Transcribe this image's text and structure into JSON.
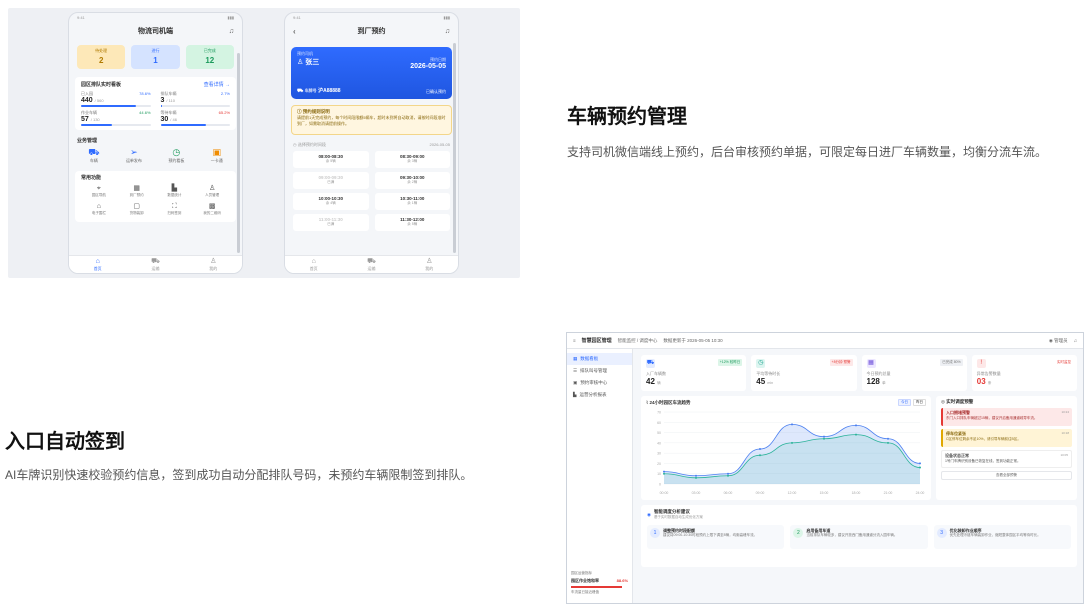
{
  "colors": {
    "accent": "#2f6bff",
    "success": "#1c9a5c",
    "warning": "#e0a800",
    "danger": "#e53935"
  },
  "phone1": {
    "title": "物流司机端",
    "stats": [
      {
        "label": "待处理",
        "value": "2"
      },
      {
        "label": "进行",
        "value": "1"
      },
      {
        "label": "已完成",
        "value": "12"
      }
    ],
    "realtime": {
      "title": "园区排队实时看板",
      "link": "查看详情 →",
      "metrics": [
        {
          "label": "已入园",
          "value": "440",
          "total": "/ 560",
          "pct": "78.6%",
          "fill": 0.786
        },
        {
          "label": "排队车辆",
          "value": "3",
          "total": "/ 110",
          "pct": "2.7%",
          "fill": 0.027
        },
        {
          "label": "作业车辆",
          "value": "57",
          "total": "/ 130",
          "pct": "44.6%",
          "fill": 0.446
        },
        {
          "label": "等待车辆",
          "value": "30",
          "total": "/ 46",
          "pct": "65.2%",
          "fill": 0.652
        }
      ]
    },
    "business_title": "业务管理",
    "business": [
      {
        "icon": "truck-icon",
        "label": "车辆"
      },
      {
        "icon": "send-icon",
        "label": "运单发布"
      },
      {
        "icon": "clock-icon",
        "label": "预约看板"
      },
      {
        "icon": "wallet-icon",
        "label": "一卡通"
      }
    ],
    "common_title": "常用功能",
    "common": [
      {
        "icon": "pin-icon",
        "label": "园区导航"
      },
      {
        "icon": "calendar-icon",
        "label": "到厂预约"
      },
      {
        "icon": "chart-icon",
        "label": "数据统计"
      },
      {
        "icon": "user-add-icon",
        "label": "人员管理"
      },
      {
        "icon": "tag-icon",
        "label": "电子围栏"
      },
      {
        "icon": "box-icon",
        "label": "货物装卸"
      },
      {
        "icon": "scan-icon",
        "label": "扫码签到"
      },
      {
        "icon": "qr-icon",
        "label": "我的二维码"
      }
    ],
    "tabs": [
      "首页",
      "运输",
      "我的"
    ]
  },
  "phone2": {
    "title": "到厂预约",
    "booking": {
      "label_driver": "预约司机",
      "driver": "张三",
      "label_date": "预约日期",
      "date": "2026-05-05",
      "label_plate": "车牌号",
      "plate": "沪A88888",
      "status": "已确认预约"
    },
    "notice_title": "预约规则说明",
    "notice_text": "请提前1天完成预约，每个时间段限额5辆车，超时未到将自动取消，请按时间段准时到厂，如需取消请提前操作。",
    "slots_title": "选择预约时间段",
    "slots_date": "2026-05-05",
    "slots": [
      {
        "time": "08:00-08:30",
        "left": "余 5辆",
        "available": true
      },
      {
        "time": "08:30-09:00",
        "left": "余 3辆",
        "available": true
      },
      {
        "time": "09:00-09:30",
        "left": "已满",
        "available": false
      },
      {
        "time": "09:30-10:00",
        "left": "余 2辆",
        "available": true
      },
      {
        "time": "10:00-10:30",
        "left": "余 4辆",
        "available": true
      },
      {
        "time": "10:30-11:00",
        "left": "余 1辆",
        "available": true
      },
      {
        "time": "11:00-11:30",
        "left": "已满",
        "available": false
      },
      {
        "time": "11:30-12:00",
        "left": "余 5辆",
        "available": true
      }
    ],
    "tabs": [
      "首页",
      "运输",
      "我的"
    ]
  },
  "feature1": {
    "title": "车辆预约管理",
    "desc": "支持司机微信端线上预约，后台审核预约单据，可限定每日进厂车辆数量，均衡分流车流。"
  },
  "feature2": {
    "title": "入口自动签到",
    "desc": "AI车牌识别快速校验预约信息，签到成功自动分配排队号码，未预约车辆限制签到排队。"
  },
  "desktop": {
    "app_title": "智慧园区管理",
    "breadcrumb": "智能监控 / 调度中心",
    "updated": "数据更新于 2026-05-05 10:30",
    "user": "管理员",
    "nav": [
      "数据看板",
      "排队叫号管理",
      "预约审核中心",
      "运营分析报表"
    ],
    "footer": {
      "label": "园区运营指标",
      "rate_label": "园区作业饱和率",
      "rate": "88.6%",
      "note": "车流量已接近峰值"
    },
    "kpis": [
      {
        "icon": "truck-icon",
        "label": "入厂车辆数",
        "value": "42",
        "unit": "辆",
        "tag": "+12% 较昨日"
      },
      {
        "icon": "clock-icon",
        "label": "平均等待时长",
        "value": "45",
        "unit": "min",
        "tag": "+8分钟 预警"
      },
      {
        "icon": "calendar-icon",
        "label": "今日预约总量",
        "value": "128",
        "unit": "单",
        "tag": "已完成 80%"
      },
      {
        "icon": "alert-icon",
        "label": "异常告警数量",
        "value": "03",
        "unit": "条",
        "tag": "实时监控"
      }
    ],
    "chart_title": "24小时园区车流趋势",
    "chart_switch": [
      "今日",
      "昨日"
    ],
    "alerts_title": "实时调度预警",
    "alerts": [
      {
        "level": "r",
        "title": "入口拥堵预警",
        "text": "东门入口排队车辆超过15辆，建议开启备用通道疏导车流。",
        "time": "10:24"
      },
      {
        "level": "y",
        "title": "停车位紧张",
        "text": "C区停车位剩余不足10%，请引导车辆前往B区。",
        "time": "10:18"
      },
      {
        "level": "n",
        "title": "设备状态正常",
        "text": "1号门车牌识别设备已恢复在线，签到功能正常。",
        "time": "10:05"
      }
    ],
    "alerts_more": "查看全部预警",
    "sugg_title": "智能调度分析建议",
    "sugg_sub": "基于实时数据自动生成优化方案",
    "suggestions": [
      {
        "n": "1",
        "title": "调整预约时段配额",
        "text": "建议将09:00-10:30时段预约上限下调至8辆，均衡高峰车流。"
      },
      {
        "n": "2",
        "title": "启用备用车道",
        "text": "当前排队车辆较多，建议开放西门备用通道分流入园车辆。"
      },
      {
        "n": "3",
        "title": "优化装卸作业顺序",
        "text": "优先处理冷链车辆装卸作业，缩短整体园区平均等待时长。"
      }
    ]
  },
  "chart_data": {
    "type": "line",
    "x": [
      "00:00",
      "03:00",
      "06:00",
      "09:00",
      "12:00",
      "15:00",
      "18:00",
      "21:00",
      "24:00"
    ],
    "series": [
      {
        "values": [
          12,
          8,
          10,
          34,
          58,
          46,
          57,
          44,
          20
        ]
      },
      {
        "values": [
          10,
          6,
          8,
          28,
          40,
          44,
          48,
          40,
          16
        ]
      }
    ],
    "ylim": [
      0,
      70
    ],
    "grid": true
  }
}
